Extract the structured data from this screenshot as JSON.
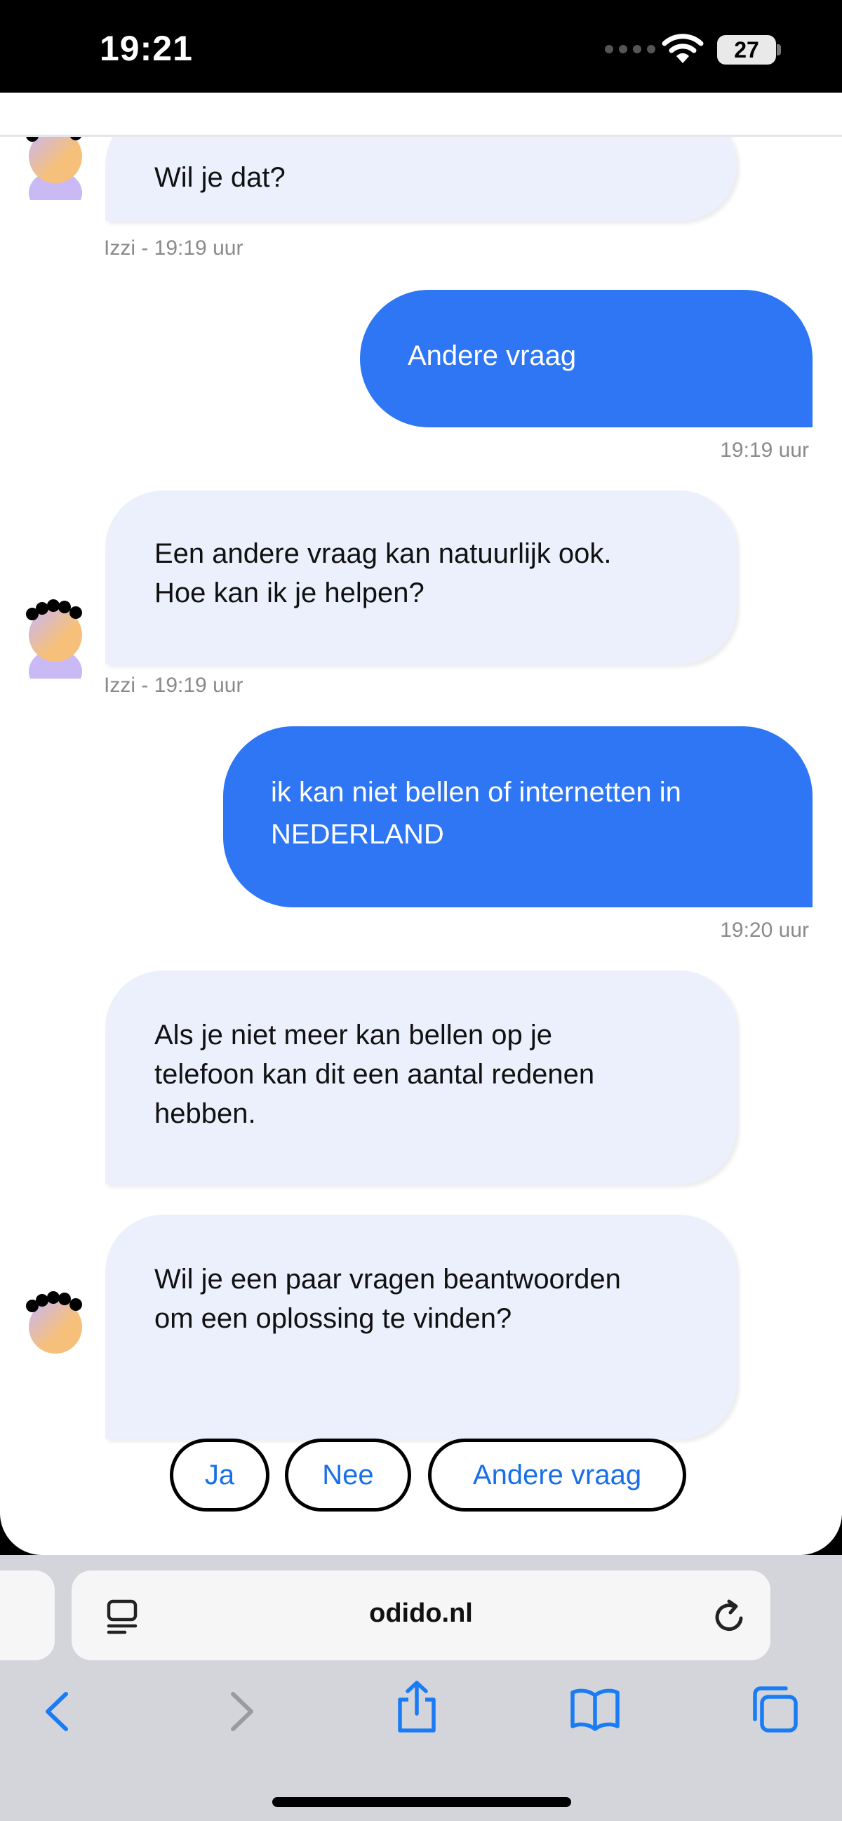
{
  "status_bar": {
    "time": "19:21",
    "battery": "27"
  },
  "chat": {
    "messages": [
      {
        "from": "bot",
        "text": "Wil je dat?",
        "meta": "Izzi - 19:19 uur"
      },
      {
        "from": "user",
        "text": "Andere vraag",
        "meta": "19:19 uur"
      },
      {
        "from": "bot",
        "lines": [
          "Een andere vraag kan natuurlijk ook.",
          "Hoe kan ik je helpen?"
        ],
        "meta": "Izzi - 19:19 uur"
      },
      {
        "from": "user",
        "lines": [
          "ik kan niet bellen of internetten in",
          "NEDERLAND"
        ],
        "meta": "19:20 uur"
      },
      {
        "from": "bot",
        "lines": [
          "Als je niet meer kan bellen op je",
          "telefoon kan dit een aantal redenen",
          "hebben."
        ]
      },
      {
        "from": "bot",
        "lines": [
          "Wil je een paar vragen beantwoorden",
          "om een oplossing te vinden?"
        ]
      }
    ],
    "quick_replies": [
      "Ja",
      "Nee",
      "Andere vraag"
    ]
  },
  "browser": {
    "url": "odido.nl"
  },
  "colors": {
    "user_bubble": "#2f76f4",
    "bot_bubble": "#ebf0fc",
    "chip_text": "#1a6fe8",
    "ios_blue": "#1a7cf5"
  },
  "icons": [
    "wifi-icon",
    "battery-icon",
    "bot-avatar",
    "reader-mode-icon",
    "reload-icon",
    "back-icon",
    "forward-icon",
    "share-icon",
    "bookmarks-icon",
    "tabs-icon"
  ]
}
